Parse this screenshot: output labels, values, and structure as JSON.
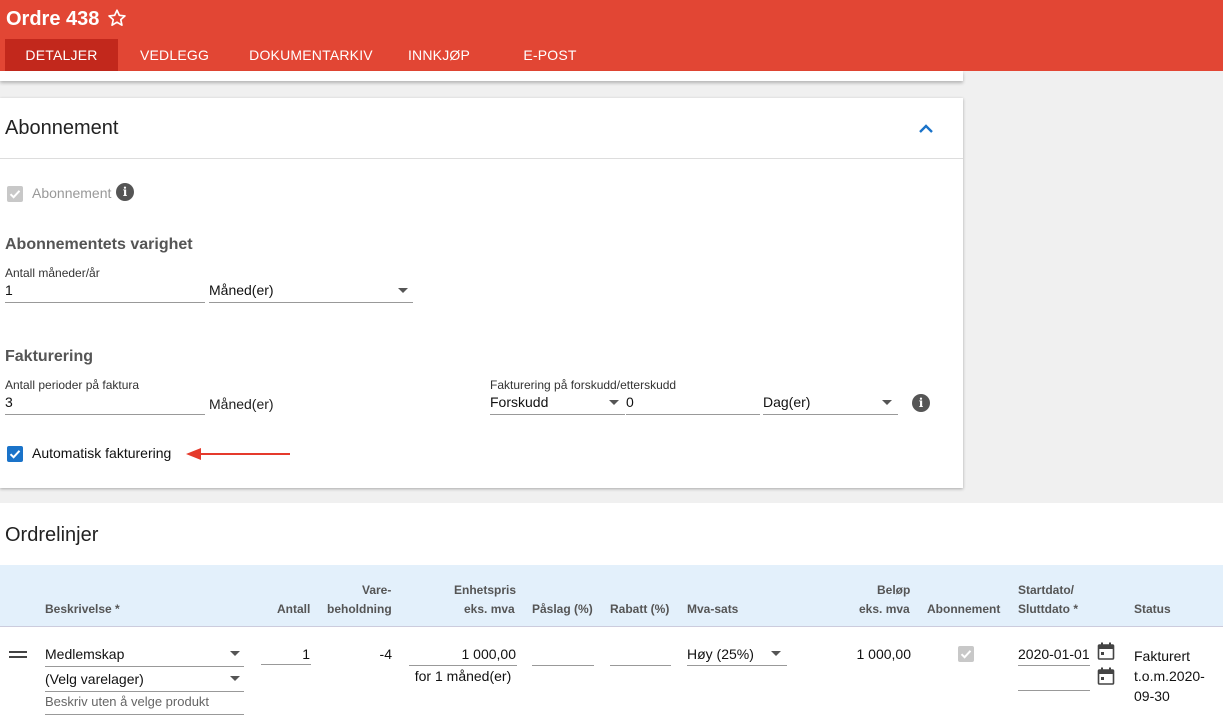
{
  "header": {
    "title": "Ordre 438",
    "tabs": [
      {
        "label": "DETALJER",
        "active": true
      },
      {
        "label": "VEDLEGG",
        "active": false
      },
      {
        "label": "DOKUMENTARKIV",
        "active": false
      },
      {
        "label": "INNKJØP",
        "active": false
      },
      {
        "label": "E-POST",
        "active": false
      }
    ]
  },
  "abonnement": {
    "title": "Abonnement",
    "checkbox_label": "Abonnement",
    "varighet": {
      "title": "Abonnementets varighet",
      "antall_label": "Antall måneder/år",
      "antall_value": "1",
      "unit_value": "Måned(er)"
    },
    "fakturering": {
      "title": "Fakturering",
      "perioder_label": "Antall perioder på faktura",
      "perioder_value": "3",
      "perioder_unit": "Måned(er)",
      "forskudd_label": "Fakturering på forskudd/etterskudd",
      "forskudd_value": "Forskudd",
      "dager_value": "0",
      "dager_unit": "Dag(er)"
    },
    "auto_label": "Automatisk fakturering"
  },
  "ordrelinjer": {
    "title": "Ordrelinjer",
    "columns": {
      "beskrivelse": "Beskrivelse *",
      "antall": "Antall",
      "vare1": "Vare-",
      "vare2": "beholdning",
      "enhet1": "Enhetspris",
      "enhet2": "eks. mva",
      "paslag": "Påslag (%)",
      "rabatt": "Rabatt (%)",
      "mva": "Mva-sats",
      "belop1": "Beløp",
      "belop2": "eks. mva",
      "abonnement": "Abonnement",
      "dato1": "Startdato/",
      "dato2": "Sluttdato *",
      "status": "Status"
    },
    "row": {
      "produkt": "Medlemskap",
      "varelager": "(Velg varelager)",
      "beskriv_placeholder": "Beskriv uten å velge produkt",
      "antall": "1",
      "beholdning": "-4",
      "enhetspris": "1 000,00",
      "periode": "for 1 måned(er)",
      "mva": "Høy (25%)",
      "belop": "1 000,00",
      "startdato": "2020-01-01",
      "status1": "Fakturert",
      "status2": "t.o.m.2020-",
      "status3": "09-30"
    }
  },
  "colors": {
    "header": "#e24634",
    "tab_active": "#c2281c",
    "checkbox": "#1a73c9",
    "arrow": "#e53a2c"
  }
}
